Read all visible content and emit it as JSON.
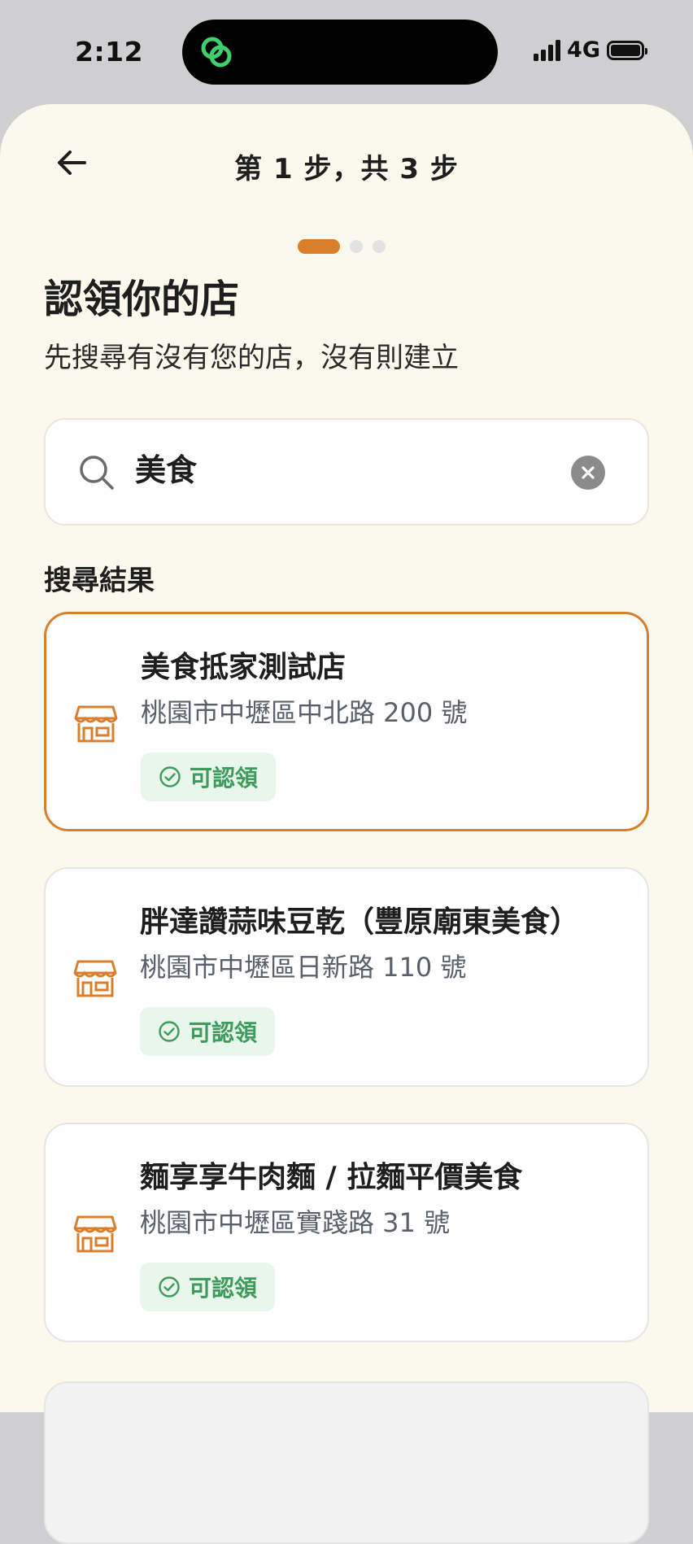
{
  "status_bar": {
    "time": "2:12",
    "network": "4G"
  },
  "header": {
    "step_text": "第 1 步，共 3 步"
  },
  "page": {
    "title": "認領你的店",
    "subtitle": "先搜尋有沒有您的店，沒有則建立"
  },
  "search": {
    "value": "美食"
  },
  "results": {
    "label": "搜尋結果",
    "items": [
      {
        "name": "美食抵家測試店",
        "address": "桃園市中壢區中北路 200 號",
        "status": "可認領"
      },
      {
        "name": "胖達讚蒜味豆乾（豐原廟東美食）",
        "address": "桃園市中壢區日新路 110 號",
        "status": "可認領"
      },
      {
        "name": "麵享享牛肉麵 / 拉麵平價美食",
        "address": "桃園市中壢區實踐路 31 號",
        "status": "可認領"
      }
    ]
  },
  "colors": {
    "accent": "#d97f2c",
    "claim_green": "#3d9b5b",
    "background": "#fbf8ec"
  },
  "icons": [
    "back-arrow-icon",
    "search-icon",
    "clear-icon",
    "store-icon",
    "check-circle-icon",
    "app-logo-icon",
    "signal-icon",
    "battery-icon"
  ]
}
